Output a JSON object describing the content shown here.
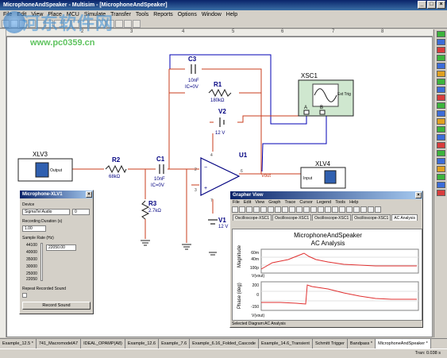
{
  "window": {
    "title": "MicrophoneAndSpeaker - Multisim - [MicrophoneAndSpeaker]"
  },
  "watermark": {
    "text_cn": "河东软件网",
    "url": "www.pc0359.cn"
  },
  "menu": [
    "File",
    "Edit",
    "View",
    "Place",
    "MCU",
    "Simulate",
    "Transfer",
    "Tools",
    "Reports",
    "Options",
    "Window",
    "Help"
  ],
  "ruler": [
    "2",
    "3",
    "4",
    "5",
    "6",
    "7",
    "8"
  ],
  "components": {
    "xsc1": "XSC1",
    "xsc1_trig": "Ext Trig",
    "xsc1_a": "A",
    "xsc1_b": "B",
    "xlv3": "XLV3",
    "xlv3_out": "Output",
    "xlv4": "XLV4",
    "xlv4_in": "Input",
    "c3": "C3",
    "c3_val": "10nF",
    "c3_ic": "IC=0V",
    "r1": "R1",
    "r1_val": "180kΩ",
    "v2": "V2",
    "v2_val": "12 V",
    "r2": "R2",
    "r2_val": "68kΩ",
    "c1": "C1",
    "c1_val": "10nF",
    "c1_ic": "IC=0V",
    "r3": "R3",
    "r3_val": "2.7kΩ",
    "u1": "U1",
    "v1": "V1",
    "v1_val": "12 V",
    "vout": "Vout",
    "pin4": "4",
    "pin2": "2",
    "pin3": "3",
    "pin6": "6",
    "pin7": "7"
  },
  "signal_window": {
    "title": "Microphone-XLV1",
    "device_label": "Device",
    "device_value": "SigmaTel Audio",
    "device_num": "0",
    "duration_label": "Recording Duration (s)",
    "duration_value": "1.00",
    "rate_label": "Sample Rate (Hz)",
    "rates": [
      "44100",
      "40000",
      "35000",
      "30000",
      "25000",
      "22050"
    ],
    "rate_value": "22050.00",
    "repeat_label": "Repeat Recorded Sound",
    "record_button": "Record Sound"
  },
  "grapher": {
    "title": "Grapher View",
    "menu": [
      "File",
      "Edit",
      "View",
      "Graph",
      "Trace",
      "Cursor",
      "Legend",
      "Tools",
      "Help"
    ],
    "tabs": [
      "Oscilloscope-XSC1",
      "Oscilloscope-XSC1",
      "Oscilloscope-XSC1",
      "Oscilloscope-XSC1",
      "AC Analysis"
    ],
    "plot_title": "MicrophoneAndSpeaker",
    "plot_subtitle": "AC Analysis",
    "mag_label": "Magnitude",
    "mag_ticks": [
      "60m",
      "40m",
      "100p"
    ],
    "phase_label": "Phase (deg)",
    "phase_ticks": [
      "200",
      "0",
      "-150"
    ],
    "trace_label": "V(vout)",
    "status": "Selected Diagram:AC Analysis"
  },
  "tabs": [
    "Example_12.5 *",
    "741_MacromodelA7",
    "IDEAL_OPAMP(A8)",
    "Example_12.6",
    "Example_7.6",
    "Example_6.16_Folded_Cascode",
    "Example_14.6_Transient",
    "Schmitt Trigger",
    "Bandpass *",
    "MicrophoneAndSpeaker *"
  ],
  "status": {
    "tran": "Tran: 0.038 s"
  },
  "colors": {
    "red_wire": "#c83c1e",
    "blue_wire": "#0000b4",
    "component": "#000080"
  }
}
